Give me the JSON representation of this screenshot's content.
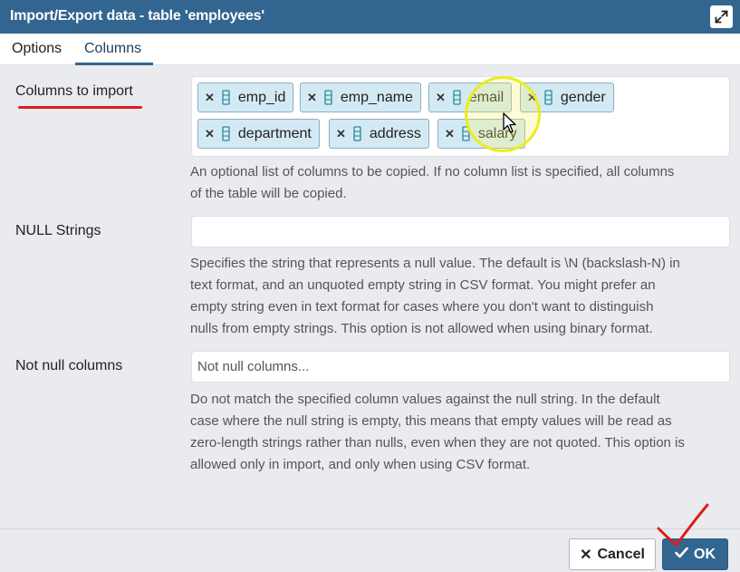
{
  "dialog": {
    "title": "Import/Export data - table 'employees'",
    "maximize_icon": "maximize-icon"
  },
  "tabs": [
    {
      "label": "Options",
      "active": false
    },
    {
      "label": "Columns",
      "active": true
    }
  ],
  "columns_to_import": {
    "label": "Columns to import",
    "tags": [
      {
        "name": "emp_id",
        "remove_icon": "close-icon",
        "icon": "column-icon"
      },
      {
        "name": "emp_name",
        "remove_icon": "close-icon",
        "icon": "column-icon"
      },
      {
        "name": "email",
        "remove_icon": "close-icon",
        "icon": "column-icon"
      },
      {
        "name": "gender",
        "remove_icon": "close-icon",
        "icon": "column-icon"
      },
      {
        "name": "department",
        "remove_icon": "close-icon",
        "icon": "column-icon"
      },
      {
        "name": "address",
        "remove_icon": "close-icon",
        "icon": "column-icon"
      },
      {
        "name": "salary",
        "remove_icon": "close-icon",
        "icon": "column-icon"
      }
    ],
    "help_lines": [
      "An optional list of columns to be copied. If no column list is specified, all columns",
      "of the table will be copied."
    ]
  },
  "null_strings": {
    "label": "NULL Strings",
    "value": "",
    "help_lines": [
      "Specifies the string that represents a null value. The default is \\N (backslash-N) in",
      "text format, and an unquoted empty string in CSV format. You might prefer an",
      "empty string even in text format for cases where you don't want to distinguish",
      "nulls from empty strings. This option is not allowed when using binary format."
    ]
  },
  "not_null_columns": {
    "label": "Not null columns",
    "placeholder": "Not null columns...",
    "help_lines": [
      "Do not match the specified column values against the null string. In the default",
      "case where the null string is empty, this means that empty values will be read as",
      "zero-length strings rather than nulls, even when they are not quoted. This option is",
      "allowed only in import, and only when using CSV format."
    ]
  },
  "footer": {
    "cancel_label": "Cancel",
    "cancel_icon": "close-icon",
    "ok_label": "OK",
    "ok_icon": "check-icon"
  },
  "colors": {
    "header": "#326690",
    "tag_background": "#d3eaf5",
    "content_background": "#eaebee",
    "annotation_red": "#e01b1b",
    "cursor_highlight": "#ecec1c"
  }
}
